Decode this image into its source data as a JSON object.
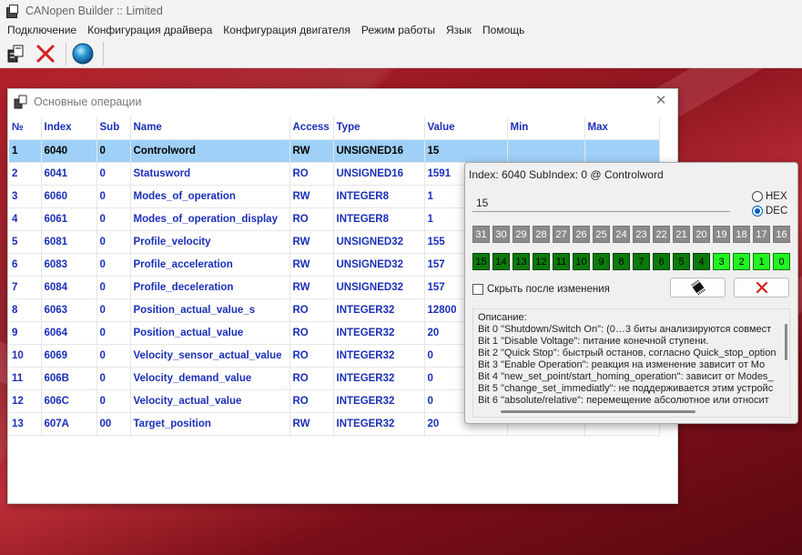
{
  "app": {
    "title": "CANopen Builder :: Limited"
  },
  "menu": [
    "Подключение",
    "Конфигурация драйвера",
    "Конфигурация двигателя",
    "Режим работы",
    "Язык",
    "Помощь"
  ],
  "toolbar": {
    "icons": [
      "connect-icon",
      "disconnect-icon",
      "globe-icon"
    ]
  },
  "mdi": {
    "title": "Основные операции",
    "close": "✕"
  },
  "table": {
    "headers": [
      "№",
      "Index",
      "Sub",
      "Name",
      "Access",
      "Type",
      "Value",
      "Min",
      "Max"
    ],
    "rows": [
      [
        "1",
        "6040",
        "0",
        "Controlword",
        "RW",
        "UNSIGNED16",
        "15",
        "",
        ""
      ],
      [
        "2",
        "6041",
        "0",
        "Statusword",
        "RO",
        "UNSIGNED16",
        "1591",
        "",
        ""
      ],
      [
        "3",
        "6060",
        "0",
        "Modes_of_operation",
        "RW",
        "INTEGER8",
        "1",
        "",
        ""
      ],
      [
        "4",
        "6061",
        "0",
        "Modes_of_operation_display",
        "RO",
        "INTEGER8",
        "1",
        "",
        ""
      ],
      [
        "5",
        "6081",
        "0",
        "Profile_velocity",
        "RW",
        "UNSIGNED32",
        "155",
        "",
        ""
      ],
      [
        "6",
        "6083",
        "0",
        "Profile_acceleration",
        "RW",
        "UNSIGNED32",
        "157",
        "",
        ""
      ],
      [
        "7",
        "6084",
        "0",
        "Profile_deceleration",
        "RW",
        "UNSIGNED32",
        "157",
        "",
        ""
      ],
      [
        "8",
        "6063",
        "0",
        "Position_actual_value_s",
        "RO",
        "INTEGER32",
        "12800",
        "",
        ""
      ],
      [
        "9",
        "6064",
        "0",
        "Position_actual_value",
        "RO",
        "INTEGER32",
        "20",
        "",
        ""
      ],
      [
        "10",
        "6069",
        "0",
        "Velocity_sensor_actual_value",
        "RO",
        "INTEGER32",
        "0",
        "",
        ""
      ],
      [
        "11",
        "606B",
        "0",
        "Velocity_demand_value",
        "RO",
        "INTEGER32",
        "0",
        "",
        ""
      ],
      [
        "12",
        "606C",
        "0",
        "Velocity_actual_value",
        "RO",
        "INTEGER32",
        "0",
        "",
        ""
      ],
      [
        "13",
        "607A",
        "00",
        "Target_position",
        "RW",
        "INTEGER32",
        "20",
        "",
        ""
      ]
    ],
    "selected_row": 0
  },
  "popup": {
    "title": "Index: 6040 SubIndex: 0 @ Controlword",
    "value": "15",
    "radio_hex": "HEX",
    "radio_dec": "DEC",
    "radio_selected": "DEC",
    "high_bits": [
      "31",
      "30",
      "29",
      "28",
      "27",
      "26",
      "25",
      "24",
      "23",
      "22",
      "21",
      "20",
      "19",
      "18",
      "17",
      "16"
    ],
    "low_bits": [
      "15",
      "14",
      "13",
      "12",
      "11",
      "10",
      "9",
      "8",
      "7",
      "6",
      "5",
      "4",
      "3",
      "2",
      "1",
      "0"
    ],
    "set_bits": [
      "3",
      "2",
      "1",
      "0"
    ],
    "checkbox_label": "Скрыть после изменения",
    "accept_icon": "chip-icon",
    "cancel_icon": "close-icon",
    "description": [
      "Описание:",
      "Bit 0 \"Shutdown/Switch On\": (0…3 биты анализируются совмест",
      "Bit 1 \"Disable Voltage\": питание конечной ступени.",
      "Bit 2 \"Quick Stop\": быстрый останов, согласно Quick_stop_option",
      "Bit 3 \"Enable Operation\": реакция на изменение зависит от Mo",
      "Bit 4 \"new_set_point/start_homing_operation\": зависит от Modes_",
      "Bit 5 \"change_set_immediatly\": не поддерживается этим устройс",
      "Bit 6 \"absolute/relative\": перемещение абсолютное или относит"
    ]
  },
  "colors": {
    "selection": "#9fd0f7",
    "table_text": "#1a2fb8",
    "bit_set": "#22f322",
    "bit_clear": "#0a7a0a",
    "bit_high": "#8a8a8a"
  }
}
